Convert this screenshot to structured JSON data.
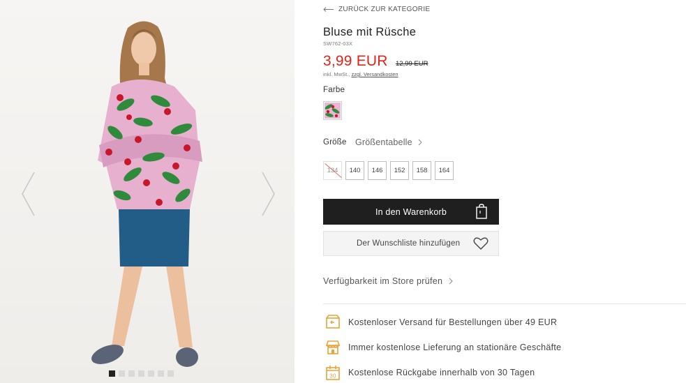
{
  "nav": {
    "back_label": "ZURÜCK ZUR KATEGORIE"
  },
  "product": {
    "title": "Bluse mit Rüsche",
    "sku": "SW762-03X",
    "price": "3,99 EUR",
    "old_price": "12,99 EUR",
    "tax_note": "inkl. MwSt.,",
    "shipping_link": "zzgl. Versandkosten"
  },
  "color": {
    "label": "Farbe",
    "selected_icon": "cherry-print-swatch"
  },
  "size": {
    "label": "Größe",
    "table_link": "Größentabelle",
    "options": [
      {
        "label": "134",
        "available": false
      },
      {
        "label": "140",
        "available": true
      },
      {
        "label": "146",
        "available": true
      },
      {
        "label": "152",
        "available": true
      },
      {
        "label": "158",
        "available": true
      },
      {
        "label": "164",
        "available": true
      }
    ]
  },
  "actions": {
    "add_to_cart": "In den Warenkorb",
    "wishlist": "Der Wunschliste hinzufügen",
    "store_check": "Verfügbarkeit im Store prüfen"
  },
  "benefits": [
    {
      "icon": "delivery-box-icon",
      "text": "Kostenloser Versand für Bestellungen über 49 EUR"
    },
    {
      "icon": "store-icon",
      "text": "Immer kostenlose Lieferung an stationäre Geschäfte"
    },
    {
      "icon": "calendar-30-icon",
      "text": "Kostenlose Rückgabe innerhalb von 30 Tagen"
    }
  ],
  "gallery": {
    "image_count": 7,
    "active_index": 0
  },
  "colors": {
    "price_red": "#e2231a",
    "button_dark": "#1f1f1f",
    "benefit_icon": "#e8a33a"
  }
}
